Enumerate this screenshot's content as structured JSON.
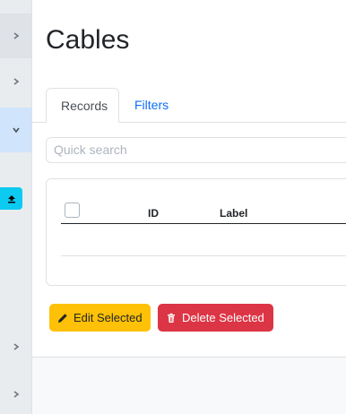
{
  "page": {
    "title": "Cables"
  },
  "tabs": [
    {
      "label": "Records",
      "active": true
    },
    {
      "label": "Filters",
      "active": false
    }
  ],
  "search": {
    "placeholder": "Quick search"
  },
  "table": {
    "columns": [
      "ID",
      "Label"
    ]
  },
  "actions": {
    "edit_label": "Edit Selected",
    "delete_label": "Delete Selected"
  },
  "sidebar": {
    "items": [
      {
        "icon": "chevron-right-icon"
      },
      {
        "icon": "chevron-right-icon"
      },
      {
        "icon": "chevron-down-icon",
        "active": true
      },
      {
        "icon": "upload-icon"
      },
      {
        "icon": "chevron-right-icon"
      },
      {
        "icon": "chevron-right-icon"
      }
    ]
  },
  "colors": {
    "primary": "#0d6efd",
    "warning": "#ffc107",
    "danger": "#dc3545",
    "info": "#0dcaf0",
    "sidebar_active": "#d0e4fb"
  }
}
